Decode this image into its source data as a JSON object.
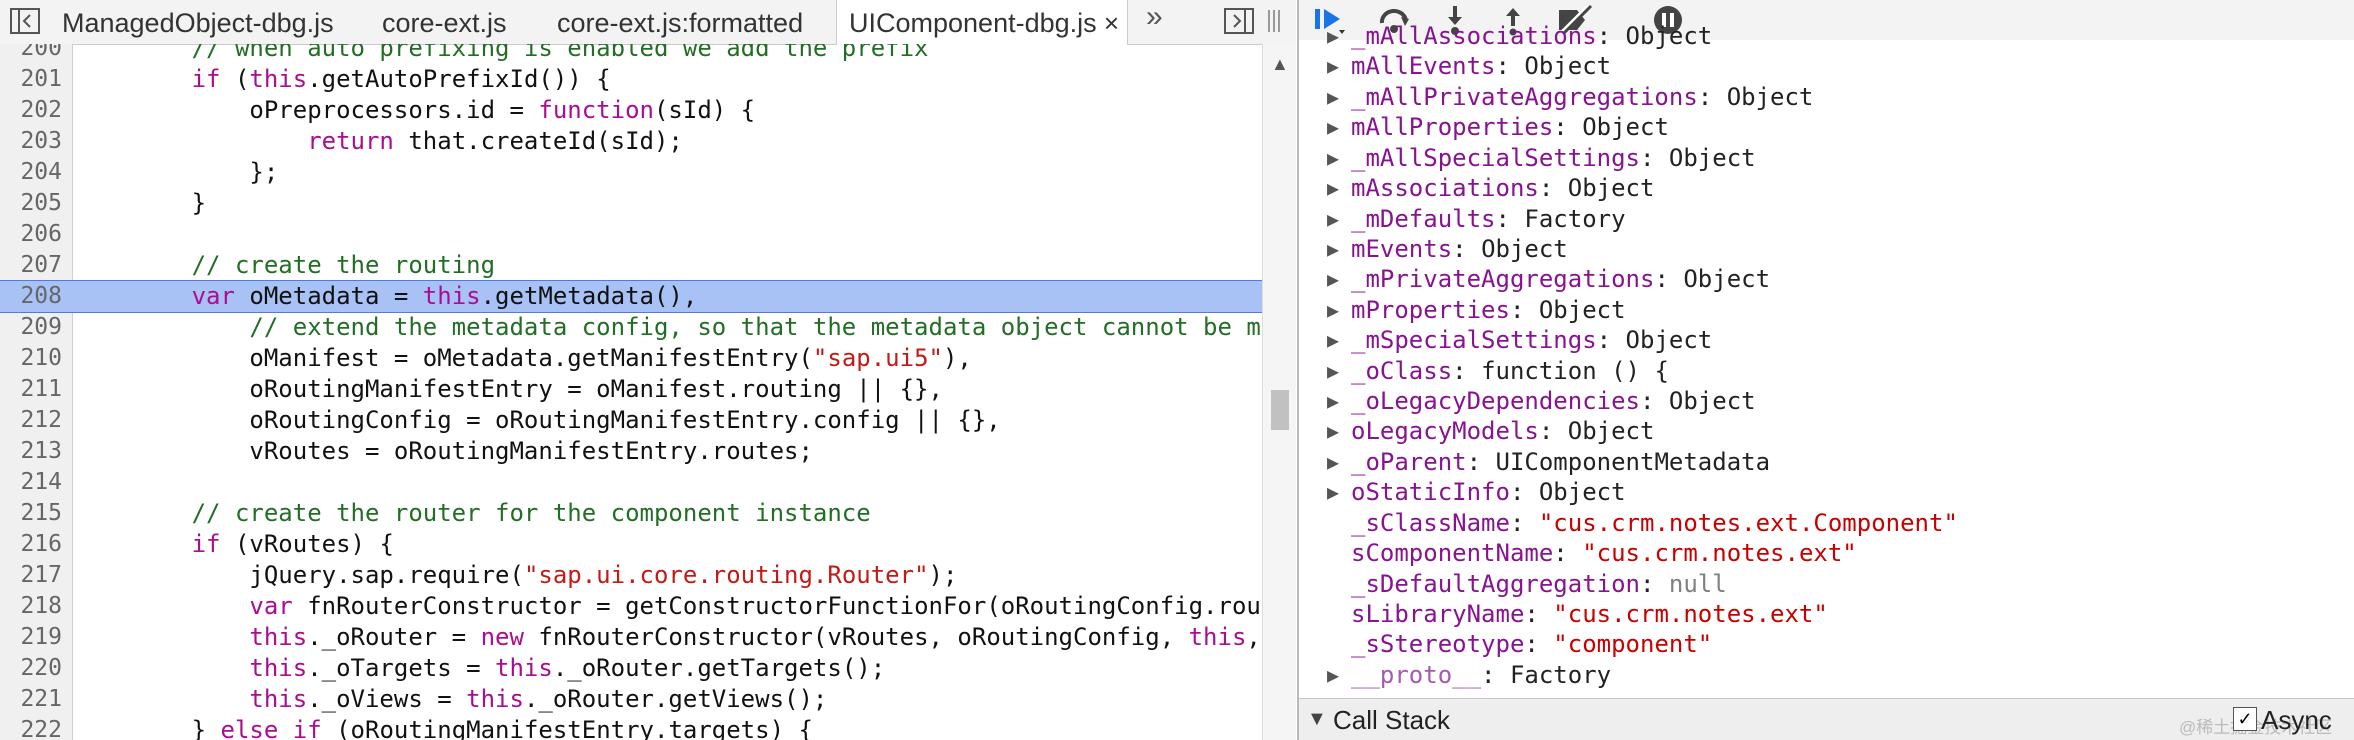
{
  "editor": {
    "tabs": [
      {
        "label": "ManagedObject-dbg.js",
        "active": false
      },
      {
        "label": "core-ext.js",
        "active": false
      },
      {
        "label": "core-ext.js:formatted",
        "active": false
      },
      {
        "label": "UIComponent-dbg.js",
        "active": true
      }
    ],
    "close_glyph": "×",
    "more_glyph": "»",
    "lines": [
      {
        "n": "200",
        "segs": [
          [
            "cm",
            "        // when auto prefixing is enabled we add the prefix"
          ]
        ]
      },
      {
        "n": "201",
        "segs": [
          [
            "",
            "        "
          ],
          [
            "kw",
            "if"
          ],
          [
            "",
            " ("
          ],
          [
            "kw",
            "this"
          ],
          [
            "",
            ".getAutoPrefixId()) {"
          ]
        ]
      },
      {
        "n": "202",
        "segs": [
          [
            "",
            "            oPreprocessors.id = "
          ],
          [
            "kw",
            "function"
          ],
          [
            "",
            "(sId) {"
          ]
        ]
      },
      {
        "n": "203",
        "segs": [
          [
            "",
            "                "
          ],
          [
            "kw",
            "return"
          ],
          [
            "",
            " that.createId(sId);"
          ]
        ]
      },
      {
        "n": "204",
        "segs": [
          [
            "",
            "            };"
          ]
        ]
      },
      {
        "n": "205",
        "segs": [
          [
            "",
            "        }"
          ]
        ]
      },
      {
        "n": "206",
        "segs": [
          [
            "",
            ""
          ]
        ]
      },
      {
        "n": "207",
        "segs": [
          [
            "cm",
            "        // create the routing"
          ]
        ]
      },
      {
        "n": "208",
        "hl": true,
        "segs": [
          [
            "",
            "        "
          ],
          [
            "kw",
            "var"
          ],
          [
            "",
            " oMetadata = "
          ],
          [
            "kw",
            "this"
          ],
          [
            "",
            ".getMetadata(),"
          ]
        ]
      },
      {
        "n": "209",
        "segs": [
          [
            "cm",
            "            // extend the metadata config, so that the metadata object cannot be m"
          ]
        ]
      },
      {
        "n": "210",
        "segs": [
          [
            "",
            "            oManifest = oMetadata.getManifestEntry("
          ],
          [
            "str",
            "\"sap.ui5\""
          ],
          [
            "",
            "),"
          ]
        ]
      },
      {
        "n": "211",
        "segs": [
          [
            "",
            "            oRoutingManifestEntry = oManifest.routing || {},"
          ]
        ]
      },
      {
        "n": "212",
        "segs": [
          [
            "",
            "            oRoutingConfig = oRoutingManifestEntry.config || {},"
          ]
        ]
      },
      {
        "n": "213",
        "segs": [
          [
            "",
            "            vRoutes = oRoutingManifestEntry.routes;"
          ]
        ]
      },
      {
        "n": "214",
        "segs": [
          [
            "",
            ""
          ]
        ]
      },
      {
        "n": "215",
        "segs": [
          [
            "cm",
            "        // create the router for the component instance"
          ]
        ]
      },
      {
        "n": "216",
        "segs": [
          [
            "",
            "        "
          ],
          [
            "kw",
            "if"
          ],
          [
            "",
            " (vRoutes) {"
          ]
        ]
      },
      {
        "n": "217",
        "segs": [
          [
            "",
            "            jQuery.sap.require("
          ],
          [
            "str",
            "\"sap.ui.core.routing.Router\""
          ],
          [
            "",
            ");"
          ]
        ]
      },
      {
        "n": "218",
        "segs": [
          [
            "",
            "            "
          ],
          [
            "kw",
            "var"
          ],
          [
            "",
            " fnRouterConstructor = getConstructorFunctionFor(oRoutingConfig.rou"
          ]
        ]
      },
      {
        "n": "219",
        "segs": [
          [
            "",
            "            "
          ],
          [
            "kw",
            "this"
          ],
          [
            "",
            "._oRouter = "
          ],
          [
            "kw",
            "new"
          ],
          [
            "",
            " fnRouterConstructor(vRoutes, oRoutingConfig, "
          ],
          [
            "kw",
            "this"
          ],
          [
            "",
            ","
          ]
        ]
      },
      {
        "n": "220",
        "segs": [
          [
            "",
            "            "
          ],
          [
            "kw",
            "this"
          ],
          [
            "",
            "._oTargets = "
          ],
          [
            "kw",
            "this"
          ],
          [
            "",
            "._oRouter.getTargets();"
          ]
        ]
      },
      {
        "n": "221",
        "segs": [
          [
            "",
            "            "
          ],
          [
            "kw",
            "this"
          ],
          [
            "",
            "._oViews = "
          ],
          [
            "kw",
            "this"
          ],
          [
            "",
            "._oRouter.getViews();"
          ]
        ]
      },
      {
        "n": "222",
        "segs": [
          [
            "",
            "        } "
          ],
          [
            "kw",
            "else if"
          ],
          [
            "",
            " (oRoutingManifestEntry.targets) {"
          ]
        ]
      }
    ]
  },
  "scope": {
    "rows": [
      {
        "arrow": true,
        "name": "_mAllAssociations",
        "dim": false,
        "sep": ": ",
        "value": "Object",
        "vtype": "obj"
      },
      {
        "arrow": true,
        "name": "mAllEvents",
        "dim": false,
        "sep": ": ",
        "value": "Object",
        "vtype": "obj"
      },
      {
        "arrow": true,
        "name": "_mAllPrivateAggregations",
        "dim": false,
        "sep": ": ",
        "value": "Object",
        "vtype": "obj"
      },
      {
        "arrow": true,
        "name": "mAllProperties",
        "dim": false,
        "sep": ": ",
        "value": "Object",
        "vtype": "obj"
      },
      {
        "arrow": true,
        "name": "_mAllSpecialSettings",
        "dim": false,
        "sep": ": ",
        "value": "Object",
        "vtype": "obj"
      },
      {
        "arrow": true,
        "name": "mAssociations",
        "dim": false,
        "sep": ": ",
        "value": "Object",
        "vtype": "obj"
      },
      {
        "arrow": true,
        "name": "_mDefaults",
        "dim": false,
        "sep": ": ",
        "value": "Factory",
        "vtype": "obj"
      },
      {
        "arrow": true,
        "name": "mEvents",
        "dim": false,
        "sep": ": ",
        "value": "Object",
        "vtype": "obj"
      },
      {
        "arrow": true,
        "name": "_mPrivateAggregations",
        "dim": false,
        "sep": ": ",
        "value": "Object",
        "vtype": "obj"
      },
      {
        "arrow": true,
        "name": "mProperties",
        "dim": false,
        "sep": ": ",
        "value": "Object",
        "vtype": "obj"
      },
      {
        "arrow": true,
        "name": "_mSpecialSettings",
        "dim": false,
        "sep": ": ",
        "value": "Object",
        "vtype": "obj"
      },
      {
        "arrow": true,
        "name": "_oClass",
        "dim": false,
        "sep": ": ",
        "value": "function () {",
        "vtype": "obj"
      },
      {
        "arrow": true,
        "name": "_oLegacyDependencies",
        "dim": false,
        "sep": ": ",
        "value": "Object",
        "vtype": "obj"
      },
      {
        "arrow": true,
        "name": "oLegacyModels",
        "dim": false,
        "sep": ": ",
        "value": "Object",
        "vtype": "obj"
      },
      {
        "arrow": true,
        "name": "_oParent",
        "dim": false,
        "sep": ": ",
        "value": "UIComponentMetadata",
        "vtype": "obj"
      },
      {
        "arrow": true,
        "name": "oStaticInfo",
        "dim": false,
        "sep": ": ",
        "value": "Object",
        "vtype": "obj"
      },
      {
        "arrow": false,
        "name": "_sClassName",
        "dim": false,
        "sep": ": ",
        "value": "\"cus.crm.notes.ext.Component\"",
        "vtype": "str"
      },
      {
        "arrow": false,
        "name": "sComponentName",
        "dim": false,
        "sep": ": ",
        "value": "\"cus.crm.notes.ext\"",
        "vtype": "str"
      },
      {
        "arrow": false,
        "name": "_sDefaultAggregation",
        "dim": false,
        "sep": ": ",
        "value": "null",
        "vtype": "null"
      },
      {
        "arrow": false,
        "name": "sLibraryName",
        "dim": false,
        "sep": ": ",
        "value": "\"cus.crm.notes.ext\"",
        "vtype": "str"
      },
      {
        "arrow": false,
        "name": "_sStereotype",
        "dim": false,
        "sep": ": ",
        "value": "\"component\"",
        "vtype": "str"
      },
      {
        "arrow": true,
        "name": "__proto__",
        "dim": true,
        "sep": ": ",
        "value": "Factory",
        "vtype": "obj"
      }
    ]
  },
  "callstack": {
    "label": "Call Stack",
    "async_label": "Async",
    "async_checked": true,
    "check_glyph": "✓",
    "watermark": "@稀土掘金技术社区"
  },
  "colors": {
    "keyword": "#aa0d91",
    "string": "#c41a16",
    "comment": "#236e25",
    "highlight": "#a8c2f5",
    "prop_name": "#881391",
    "toolbar_accent": "#1a73e8"
  }
}
